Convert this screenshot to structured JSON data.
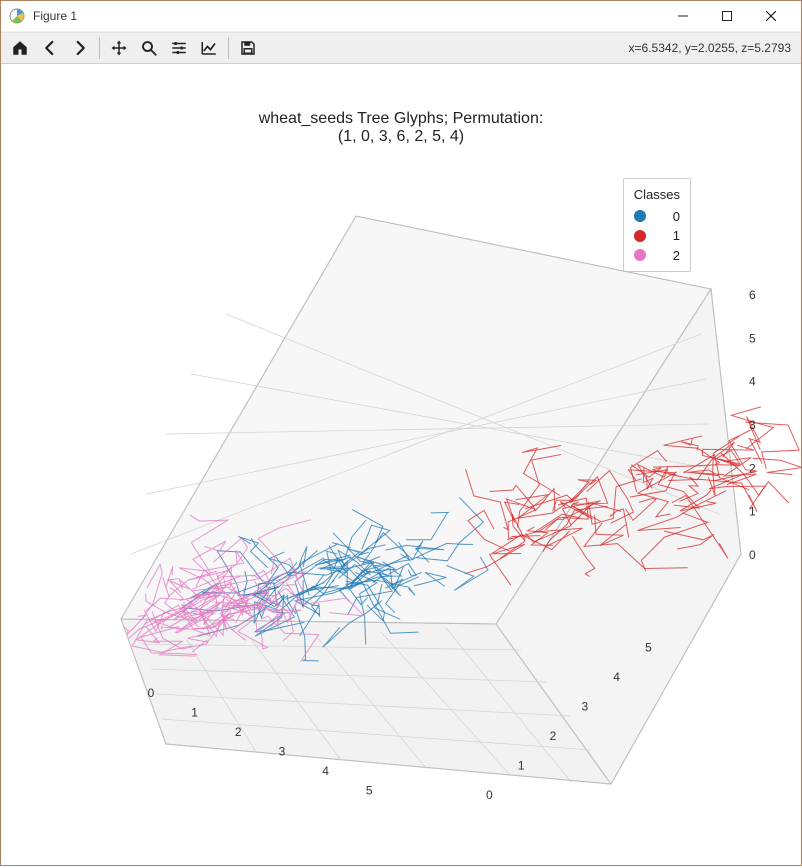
{
  "window": {
    "title": "Figure 1"
  },
  "status": {
    "coords": "x=6.5342, y=2.0255, z=5.2793"
  },
  "chart_data": {
    "type": "scatter",
    "title_line1": "wheat_seeds Tree Glyphs; Permutation:",
    "title_line2": "(1, 0, 3, 6, 2, 5, 4)",
    "axes": {
      "x": {
        "range": [
          0,
          5.5
        ],
        "ticks": [
          0,
          1,
          2,
          3,
          4,
          5
        ]
      },
      "y": {
        "range": [
          0,
          5.5
        ],
        "ticks": [
          0,
          1,
          2,
          3,
          4,
          5
        ]
      },
      "z": {
        "range": [
          0,
          6
        ],
        "ticks": [
          0,
          1,
          2,
          3,
          4,
          5,
          6
        ]
      }
    },
    "legend": {
      "title": "Classes",
      "items": [
        {
          "label": "0",
          "color": "#1f77b4",
          "style": "background:#1f77b4"
        },
        {
          "label": "1",
          "color": "#d62728",
          "style": "background:#d62728"
        },
        {
          "label": "2",
          "color": "#e377c2",
          "style": "background:#e377c2"
        }
      ]
    },
    "series": [
      {
        "name": "0",
        "color": "#1f77b4",
        "centroids": [
          [
            1.4,
            1.2,
            0.9
          ],
          [
            1.8,
            1.6,
            1.2
          ],
          [
            2.2,
            2.0,
            1.6
          ],
          [
            2.5,
            2.3,
            1.9
          ],
          [
            2.9,
            2.6,
            2.2
          ],
          [
            2.1,
            1.4,
            1.1
          ],
          [
            1.6,
            1.9,
            1.4
          ],
          [
            2.7,
            2.1,
            1.7
          ],
          [
            2.0,
            2.4,
            1.5
          ],
          [
            2.4,
            1.8,
            1.3
          ]
        ]
      },
      {
        "name": "1",
        "color": "#d62728",
        "centroids": [
          [
            3.5,
            3.3,
            3.1
          ],
          [
            3.9,
            3.7,
            3.6
          ],
          [
            4.3,
            4.0,
            4.0
          ],
          [
            4.7,
            4.4,
            4.6
          ],
          [
            5.1,
            4.8,
            5.2
          ],
          [
            4.0,
            3.4,
            3.3
          ],
          [
            4.5,
            4.6,
            4.8
          ],
          [
            5.0,
            4.2,
            4.4
          ],
          [
            3.7,
            4.1,
            3.8
          ],
          [
            4.9,
            4.9,
            5.4
          ]
        ]
      },
      {
        "name": "2",
        "color": "#e377c2",
        "centroids": [
          [
            0.4,
            0.4,
            0.3
          ],
          [
            0.8,
            0.7,
            0.5
          ],
          [
            1.1,
            1.0,
            0.7
          ],
          [
            1.3,
            1.3,
            0.8
          ],
          [
            0.6,
            1.1,
            0.4
          ],
          [
            1.0,
            0.5,
            0.6
          ],
          [
            1.5,
            1.1,
            0.9
          ],
          [
            0.9,
            1.4,
            0.7
          ],
          [
            1.2,
            0.8,
            0.5
          ],
          [
            0.5,
            0.9,
            0.4
          ]
        ]
      }
    ]
  }
}
